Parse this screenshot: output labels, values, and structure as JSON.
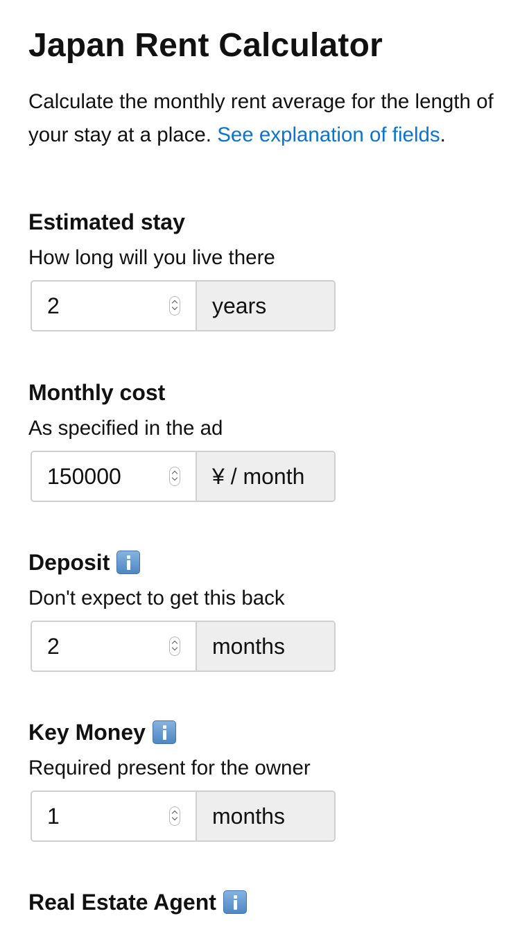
{
  "page": {
    "title": "Japan Rent Calculator",
    "intro_text": "Calculate the monthly rent average for the length of your stay at a place. ",
    "intro_link": "See explanation of fields",
    "intro_end": "."
  },
  "fields": {
    "stay": {
      "label": "Estimated stay",
      "hint": "How long will you live there",
      "value": "2",
      "unit": "years"
    },
    "monthly": {
      "label": "Monthly cost",
      "hint": "As specified in the ad",
      "value": "150000",
      "unit": "¥ / month"
    },
    "deposit": {
      "label": "Deposit",
      "hint": "Don't expect to get this back",
      "value": "2",
      "unit": "months",
      "icon": "info-icon"
    },
    "key_money": {
      "label": "Key Money",
      "hint": "Required present for the owner",
      "value": "1",
      "unit": "months",
      "icon": "info-icon"
    },
    "agent": {
      "label": "Real Estate Agent",
      "icon": "info-icon"
    }
  },
  "colors": {
    "link": "#0a74d1",
    "unit_background": "#eeeeee",
    "border": "#cfcfcf"
  }
}
